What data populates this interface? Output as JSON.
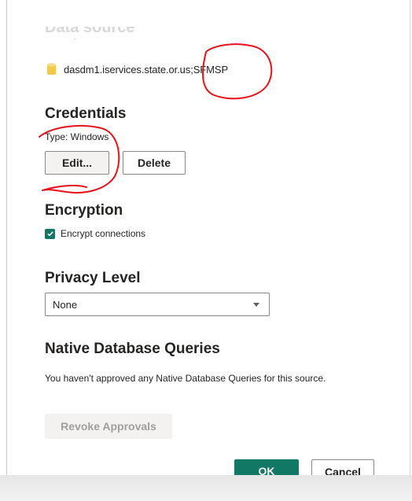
{
  "header": {
    "cut_heading": "Data source settings",
    "source_name": "dasdm1.iservices.state.or.us;SFMSP",
    "source_icon": "database-icon"
  },
  "credentials": {
    "title": "Credentials",
    "type_label": "Type: Windows",
    "edit_label": "Edit...",
    "delete_label": "Delete"
  },
  "encryption": {
    "title": "Encryption",
    "checkbox_label": "Encrypt connections",
    "checked": true
  },
  "privacy": {
    "title": "Privacy Level",
    "selected": "None"
  },
  "native_queries": {
    "title": "Native Database Queries",
    "description": "You haven't approved any Native Database Queries for this source.",
    "revoke_label": "Revoke Approvals"
  },
  "footer": {
    "ok_label": "OK",
    "cancel_label": "Cancel"
  },
  "colors": {
    "accent": "#117865",
    "annotation": "#e8101b",
    "db_icon": "#f2c94c",
    "disabled_text": "#a19f9d"
  }
}
